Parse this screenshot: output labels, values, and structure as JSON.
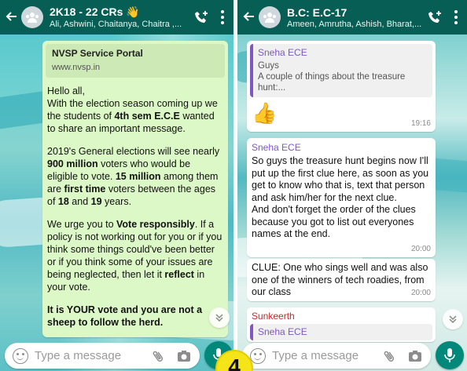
{
  "left_chat": {
    "title": "2K18 - 22 CRs",
    "title_emoji": "👋",
    "members": "Ali, Ashwini, Chaitanya, Chaitra ,...",
    "link_preview": {
      "title": "NVSP Service Portal",
      "url": "www.nvsp.in"
    },
    "message": {
      "p1_a": "Hello all,",
      "p1_b": "With the election season coming up we the students of ",
      "p1_c": "4th sem E.C.E",
      "p1_d": " wanted to share an important message.",
      "p2_a": "2019's General elections will see nearly ",
      "p2_b": "900 million",
      "p2_c": " voters who would be eligible to vote. ",
      "p2_d": "15 million",
      "p2_e": " among them are ",
      "p2_f": "first time",
      "p2_g": " voters between the ages of ",
      "p2_h": "18",
      "p2_i": " and ",
      "p2_j": "19",
      "p2_k": " years.",
      "p3_a": "We urge you to ",
      "p3_b": "Vote responsibly",
      "p3_c": ". If a policy is not working out for you or if you think some things could've been better or if you think some of your issues are being neglected, then let it ",
      "p3_d": "reflect",
      "p3_e": " in your vote.",
      "p4": "It is YOUR vote and you are not a sheep to follow the herd."
    },
    "input_placeholder": "Type a message"
  },
  "right_chat": {
    "title": "B.C: E.C-17",
    "members": "Ameen, Amrutha, Ashish, Bharat,...",
    "messages": [
      {
        "quote_author": "Sneha ECE",
        "quote_text": "Guys\nA couple of things about the treasure hunt:...",
        "emoji": "👍",
        "time": "19:16"
      },
      {
        "sender": "Sneha ECE",
        "text": "So guys the treasure hunt begins now I'll put up the first clue here, as soon as you get to know who that is, text that person and ask him/her for the next clue.\nAnd don't forget the order of the clues because you got to list out everyones names at the end.",
        "time": "20:00"
      },
      {
        "text": "CLUE: One who sings well and was also one of the winners of tech roadies, from our class",
        "time": "20:00"
      },
      {
        "sender": "Sunkeerth",
        "quote_author": "Sneha ECE"
      }
    ],
    "input_placeholder": "Type a message"
  },
  "step_badge": "4",
  "colors": {
    "header": "#075e54",
    "outgoing_bubble": "#dcf8c6",
    "incoming_bubble": "#ffffff",
    "mic_button": "#00897b",
    "quote_accent": "#7e57c2",
    "sender_sneha": "#7e57c2",
    "sender_sunkeerth": "#c62828",
    "badge": "#f5e418"
  },
  "icons": [
    "back-arrow-icon",
    "group-avatar-icon",
    "add-call-icon",
    "more-options-icon",
    "emoji-icon",
    "attach-icon",
    "camera-icon",
    "mic-icon",
    "scroll-down-icon"
  ]
}
